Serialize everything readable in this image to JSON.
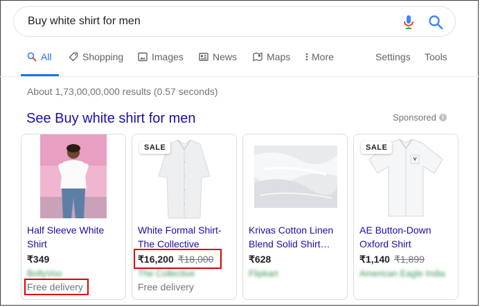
{
  "search": {
    "query": "Buy white shirt for men"
  },
  "tabs": [
    {
      "label": "All",
      "icon": "search-icon",
      "active": true
    },
    {
      "label": "Shopping",
      "icon": "tag-icon"
    },
    {
      "label": "Images",
      "icon": "image-icon"
    },
    {
      "label": "News",
      "icon": "news-icon"
    },
    {
      "label": "Maps",
      "icon": "map-icon"
    },
    {
      "label": "More",
      "icon": "more-vert-icon"
    }
  ],
  "tools": {
    "settings": "Settings",
    "tools": "Tools"
  },
  "stats": "About 1,73,00,00,000 results (0.57 seconds)",
  "ads": {
    "title": "See Buy white shirt for men",
    "sponsored": "Sponsored",
    "info_icon": "i",
    "sale_label": "SALE",
    "products": [
      {
        "title": "Half Sleeve White Shirt",
        "price": "₹349",
        "old_price": "",
        "merchant": "BollyVoo",
        "delivery": "Free delivery",
        "sale": false
      },
      {
        "title": "White Formal Shirt- The Collective",
        "price": "₹16,200",
        "old_price": "₹18,000",
        "merchant": "The Collective",
        "delivery": "Free delivery",
        "sale": true
      },
      {
        "title": "Krivas Cotton Linen Blend Solid Shirt…",
        "price": "₹628",
        "old_price": "",
        "merchant": "Flipkart",
        "delivery": "",
        "sale": false
      },
      {
        "title": "AE Button-Down Oxford Shirt",
        "price": "₹1,140",
        "old_price": "₹1,899",
        "merchant": "American Eagle India",
        "delivery": "",
        "sale": true
      }
    ]
  },
  "colors": {
    "link": "#1a0dab",
    "accent": "#1a73e8",
    "highlight": "#e00000",
    "merchant": "#188038"
  }
}
